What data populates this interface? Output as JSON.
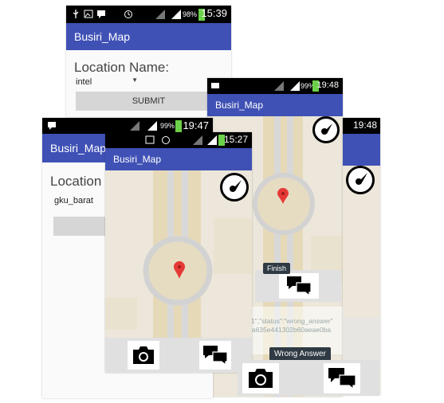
{
  "app": {
    "title": "Busiri_Map"
  },
  "screens": {
    "s1": {
      "time": "15:39",
      "battery": "98%",
      "title": "Busiri_Map",
      "form_label": "Location Name:",
      "selected_location": "intel",
      "submit_label": "SUBMIT"
    },
    "s2": {
      "time": "19:47",
      "battery": "99%",
      "title": "Busiri_Map",
      "form_label": "Location",
      "selected_location": "gku_barat"
    },
    "s3": {
      "time": "15:27",
      "title": "Busiri_Map"
    },
    "s4": {
      "time": "19:48",
      "battery": "99%",
      "title": "Busiri_Map",
      "finish_tooltip": "Finish",
      "response_text": "SE:\n3513111\",\"status\":\"wrong_answer\"\n2b723ca635e441302b60aeae0ba",
      "wrong_answer_tooltip": "Wrong Answer"
    },
    "s5": {
      "time": "19:48"
    }
  },
  "colors": {
    "appbar": "#3f51b5",
    "statusbar": "#000000",
    "map_bg": "#ece7da",
    "pin": "#e53935",
    "tooltip": "#2f3a44"
  },
  "icons": [
    "usb-icon",
    "image-icon",
    "chat-icon",
    "alarm-icon",
    "signal-icon",
    "battery-icon",
    "compass-icon",
    "camera-icon",
    "chat-bubbles-icon",
    "map-pin-icon"
  ]
}
